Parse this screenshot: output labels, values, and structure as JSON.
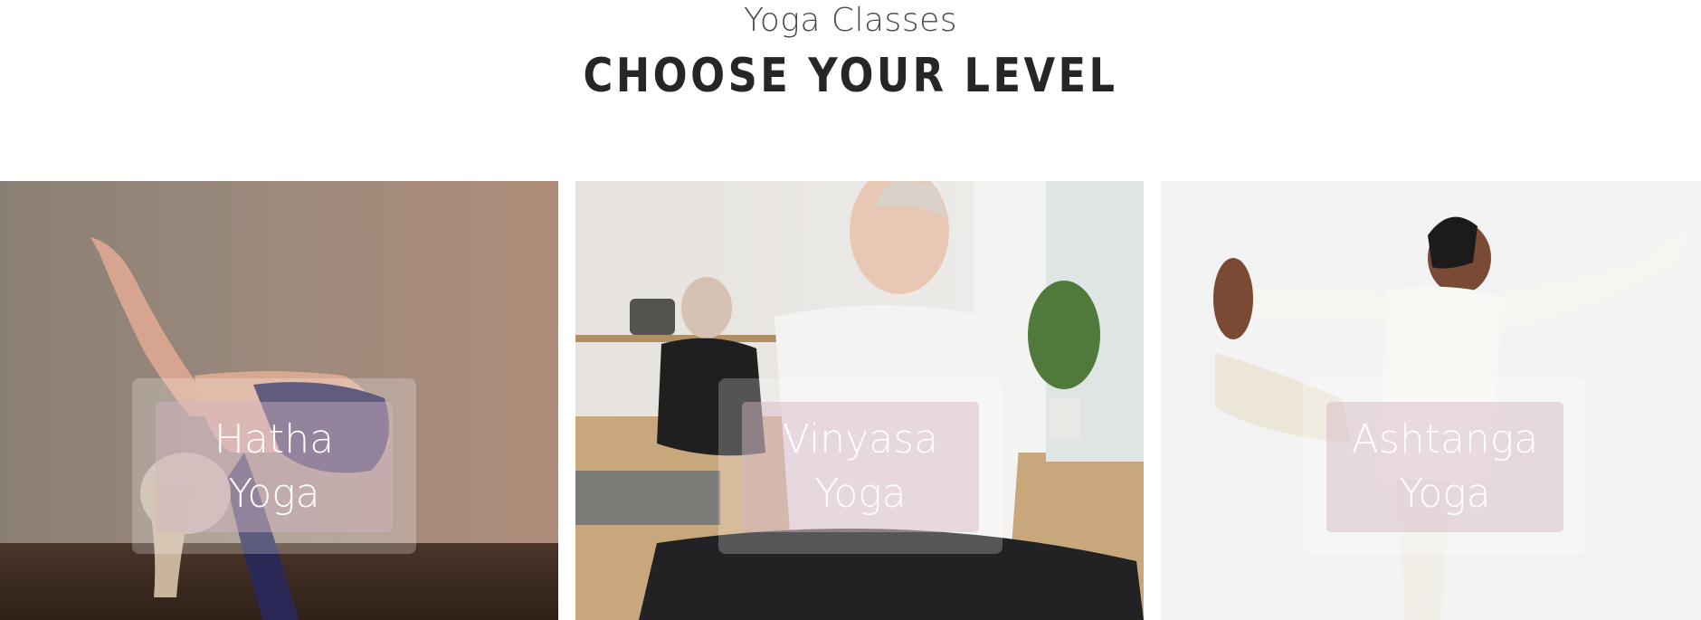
{
  "header": {
    "subtitle": "Yoga Classes",
    "title": "CHOOSE YOUR LEVEL"
  },
  "cards": [
    {
      "line1": "Hatha",
      "line2": "Yoga"
    },
    {
      "line1": "Vinyasa",
      "line2": "Yoga"
    },
    {
      "line1": "Ashtanga",
      "line2": "Yoga"
    }
  ],
  "colors": {
    "title": "#262626",
    "subtitle": "#4a4a4a",
    "label_box": "#d2b4c3",
    "label_text": "#ffffff"
  }
}
